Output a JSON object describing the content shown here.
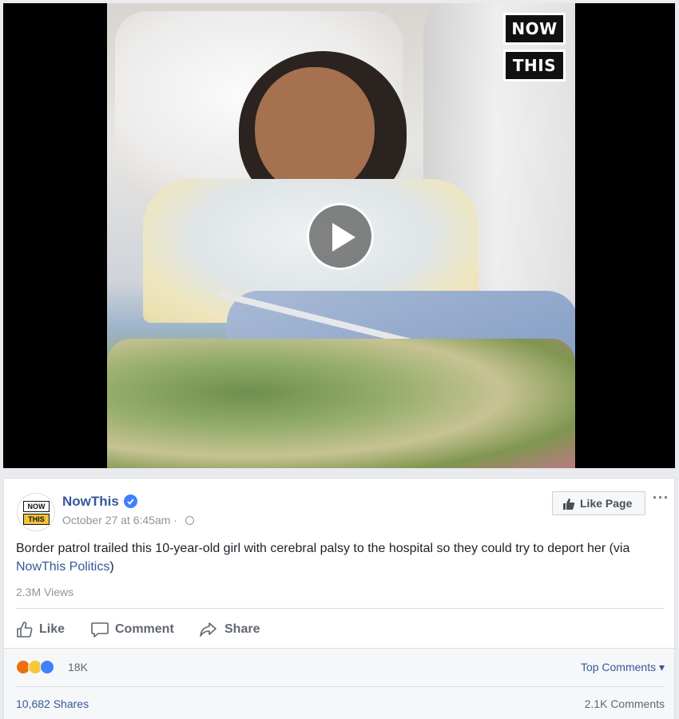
{
  "video": {
    "brand_badge": [
      "NOW",
      "THIS"
    ]
  },
  "post": {
    "page_name": "NowThis",
    "avatar_text": [
      "NOW",
      "THIS"
    ],
    "timestamp": "October 27 at 6:45am ·",
    "like_page_label": "Like Page",
    "more_label": "···",
    "text_main": "Border patrol trailed this 10-year-old girl with cerebral palsy to the hospital so they could try to deport her (via ",
    "text_link": "NowThis Politics",
    "text_end": ")",
    "views": "2.3M Views"
  },
  "actions": {
    "like": "Like",
    "comment": "Comment",
    "share": "Share"
  },
  "footer": {
    "reaction_count": "18K",
    "top_comments": "Top Comments ▾",
    "shares": "10,682 Shares",
    "comments": "2.1K Comments"
  },
  "colors": {
    "link": "#365899",
    "verified": "#4080ff",
    "muted": "#90949c"
  }
}
